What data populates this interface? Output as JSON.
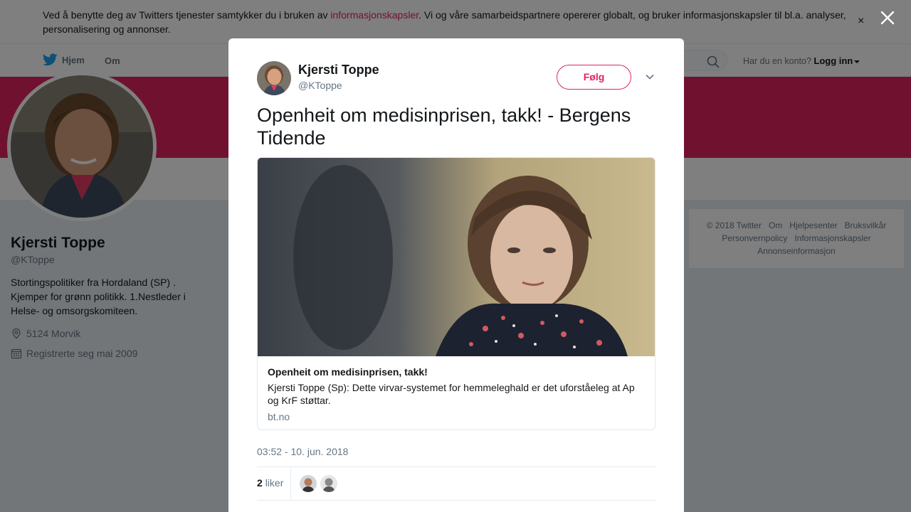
{
  "cookie_banner": {
    "text_before": "Ved å benytte deg av Twitters tjenester samtykker du i bruken av ",
    "link": "informasjonskapsler",
    "text_after": ". Vi og våre samarbeidspartnere opererer globalt, og bruker informasjonskapsler til bl.a. analyser, personalisering og annonser.",
    "close_label": "×"
  },
  "nav": {
    "home": "Hjem",
    "about": "Om",
    "login_question": "Har du en konto?",
    "login_link": "Logg inn"
  },
  "profile": {
    "name": "Kjersti Toppe",
    "handle": "@KToppe",
    "bio": "Stortingspolitiker fra Hordaland (SP) . Kjemper for grønn politikk. 1.Nestleder i Helse- og omsorgskomiteen.",
    "location": "5124 Morvik",
    "joined": "Registrerte seg mai 2009"
  },
  "footer": {
    "links": [
      "© 2018 Twitter",
      "Om",
      "Hjelpesenter",
      "Bruksvilkår",
      "Personvernpolicy",
      "Informasjonskapsler",
      "Annonseinformasjon"
    ]
  },
  "tweet": {
    "author_name": "Kjersti Toppe",
    "author_handle": "@KToppe",
    "follow_label": "Følg",
    "text": "Openheit om medisinprisen, takk! - Bergens Tidende",
    "card": {
      "title": "Openheit om medisinprisen, takk!",
      "description": "Kjersti Toppe (Sp): Dette virvar-systemet for hemmeleghald er det uforståeleg at Ap og KrF støttar.",
      "domain": "bt.no"
    },
    "timestamp": "03:52 - 10. jun. 2018",
    "likes_count": "2",
    "likes_label": "liker"
  },
  "colors": {
    "accent": "#e0245e",
    "muted": "#657786"
  }
}
